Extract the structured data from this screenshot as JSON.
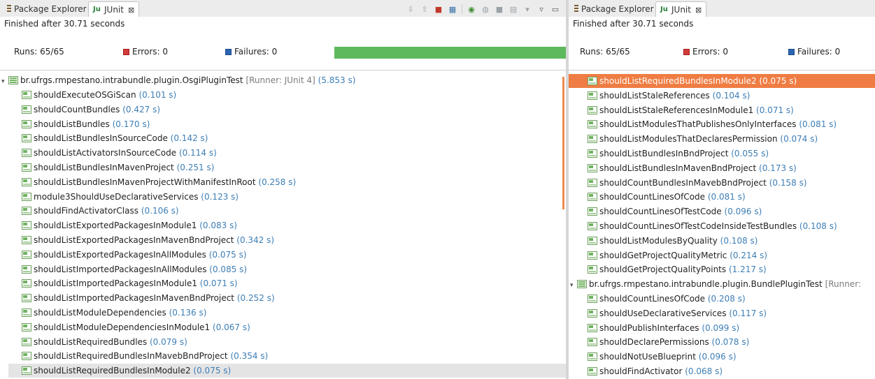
{
  "left": {
    "tabs": [
      {
        "label": "Package Explorer",
        "icon": "package-explorer-icon"
      },
      {
        "label": "JUnit",
        "icon": "junit-icon",
        "close": "⊠"
      }
    ],
    "toolbar_icons": [
      "next-failure-icon",
      "previous-failure-icon",
      "failures-only-icon",
      "scroll-lock-icon",
      "rerun-icon",
      "rerun-failed-icon",
      "stop-icon",
      "history-icon",
      "view-menu-icon",
      "minimize-icon"
    ],
    "status": "Finished after 30.71 seconds",
    "runs_label": "Runs:",
    "runs_value": "65/65",
    "errors_label": "Errors:",
    "errors_value": "0",
    "failures_label": "Failures:",
    "failures_value": "0",
    "progress": 1.0,
    "suite": {
      "name": "br.ufrgs.rmpestano.intrabundle.plugin.OsgiPluginTest",
      "runner": "[Runner: JUnit 4]",
      "time": "(5.853 s)",
      "expander": "▾"
    },
    "tests": [
      {
        "name": "shouldExecuteOSGiScan",
        "time": "(0.101 s)"
      },
      {
        "name": "shouldCountBundles",
        "time": "(0.427 s)"
      },
      {
        "name": "shouldListBundles",
        "time": "(0.170 s)"
      },
      {
        "name": "shouldListBundlesInSourceCode",
        "time": "(0.142 s)"
      },
      {
        "name": "shouldListActivatorsInSourceCode",
        "time": "(0.114 s)"
      },
      {
        "name": "shouldListBundlesInMavenProject",
        "time": "(0.251 s)"
      },
      {
        "name": "shouldListBundlesInMavenProjectWithManifestInRoot",
        "time": "(0.258 s)"
      },
      {
        "name": "module3ShouldUseDeclarativeServices",
        "time": "(0.123 s)"
      },
      {
        "name": "shouldFindActivatorClass",
        "time": "(0.106 s)"
      },
      {
        "name": "shouldListExportedPackagesInModule1",
        "time": "(0.083 s)"
      },
      {
        "name": "shouldListExportedPackagesInMavenBndProject",
        "time": "(0.342 s)"
      },
      {
        "name": "shouldListExportedPackagesInAllModules",
        "time": "(0.075 s)"
      },
      {
        "name": "shouldListImportedPackagesInAllModules",
        "time": "(0.085 s)"
      },
      {
        "name": "shouldListImportedPackagesInModule1",
        "time": "(0.071 s)"
      },
      {
        "name": "shouldListImportedPackagesInMavenBndProject",
        "time": "(0.252 s)"
      },
      {
        "name": "shouldListModuleDependencies",
        "time": "(0.136 s)"
      },
      {
        "name": "shouldListModuleDependenciesInModule1",
        "time": "(0.067 s)"
      },
      {
        "name": "shouldListRequiredBundles",
        "time": "(0.079 s)"
      },
      {
        "name": "shouldListRequiredBundlesInMavebBndProject",
        "time": "(0.354 s)"
      },
      {
        "name": "shouldListRequiredBundlesInModule2",
        "time": "(0.075 s)"
      }
    ]
  },
  "right": {
    "tabs": [
      {
        "label": "Package Explorer",
        "icon": "package-explorer-icon"
      },
      {
        "label": "JUnit",
        "icon": "junit-icon",
        "close": "⊠"
      }
    ],
    "status": "Finished after 30.71 seconds",
    "runs_label": "Runs:",
    "runs_value": "65/65",
    "errors_label": "Errors:",
    "errors_value": "0",
    "failures_label": "Failures:",
    "failures_value": "0",
    "tests_top": [
      {
        "name": "shouldListRequiredBundlesInModule2",
        "time": "(0.075 s)"
      },
      {
        "name": "shouldListStaleReferences",
        "time": "(0.104 s)"
      },
      {
        "name": "shouldListStaleReferencesInModule1",
        "time": "(0.071 s)"
      },
      {
        "name": "shouldListModulesThatPublishesOnlyInterfaces",
        "time": "(0.081 s)"
      },
      {
        "name": "shouldListModulesThatDeclaresPermission",
        "time": "(0.074 s)"
      },
      {
        "name": "shouldListBundlesInBndProject",
        "time": "(0.055 s)"
      },
      {
        "name": "shouldListBundlesInMavenBndProject",
        "time": "(0.173 s)"
      },
      {
        "name": "shouldCountBundlesInMavebBndProject",
        "time": "(0.158 s)"
      },
      {
        "name": "shouldCountLinesOfCode",
        "time": "(0.081 s)"
      },
      {
        "name": "shouldCountLinesOfTestCode",
        "time": "(0.096 s)"
      },
      {
        "name": "shouldCountLinesOfTestCodeInsideTestBundles",
        "time": "(0.108 s)"
      },
      {
        "name": "shouldListModulesByQuality",
        "time": "(0.108 s)"
      },
      {
        "name": "shouldGetProjectQualityMetric",
        "time": "(0.214 s)"
      },
      {
        "name": "shouldGetProjectQualityPoints",
        "time": "(1.217 s)"
      }
    ],
    "suite2": {
      "name": "br.ufrgs.rmpestano.intrabundle.plugin.BundlePluginTest",
      "runner": "[Runner:",
      "expander": "▾"
    },
    "tests_bottom": [
      {
        "name": "shouldCountLinesOfCode",
        "time": "(0.208 s)"
      },
      {
        "name": "shouldUseDeclarativeServices",
        "time": "(0.117 s)"
      },
      {
        "name": "shouldPublishInterfaces",
        "time": "(0.099 s)"
      },
      {
        "name": "shouldDeclarePermissions",
        "time": "(0.078 s)"
      },
      {
        "name": "shouldNotUseBlueprint",
        "time": "(0.096 s)"
      },
      {
        "name": "shouldFindActivator",
        "time": "(0.068 s)"
      }
    ]
  }
}
